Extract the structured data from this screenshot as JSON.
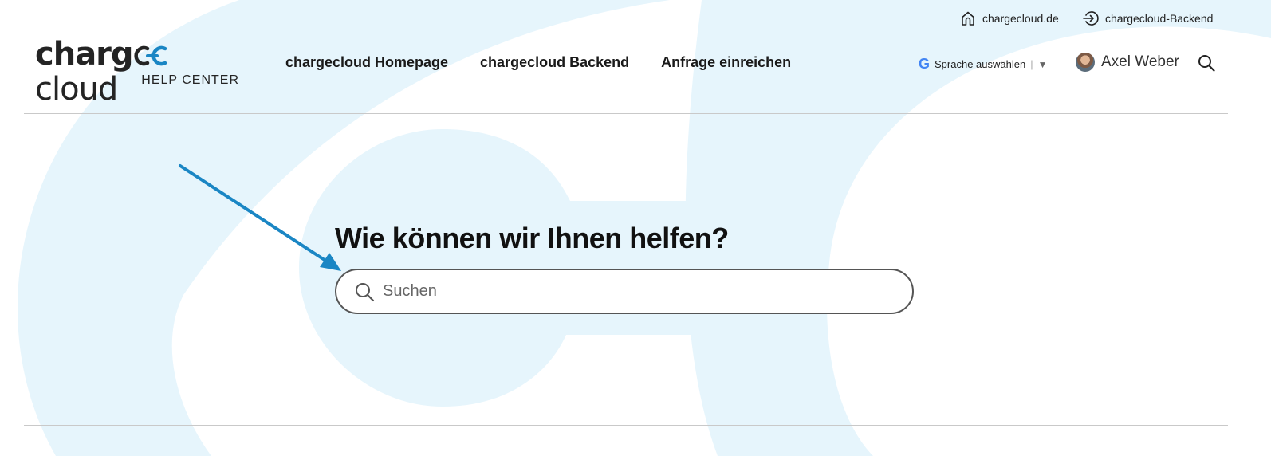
{
  "utility_links": [
    {
      "label": "chargecloud.de",
      "icon": "home-icon"
    },
    {
      "label": "chargecloud-Backend",
      "icon": "login-arrow-icon"
    }
  ],
  "logo": {
    "word_part1": "charg",
    "word_part2": "cloud",
    "subtitle": "HELP CENTER"
  },
  "nav": [
    {
      "label": "chargecloud Homepage"
    },
    {
      "label": "chargecloud Backend"
    },
    {
      "label": "Anfrage einreichen"
    }
  ],
  "language": {
    "g_letter": "G",
    "label": "Sprache auswählen",
    "separator": "|",
    "dropdown": "▼"
  },
  "user": {
    "name": "Axel Weber"
  },
  "hero": {
    "title": "Wie können wir Ihnen helfen?",
    "search_placeholder": "Suchen"
  },
  "colors": {
    "background_shape": "#e6f5fc",
    "accent_arrow": "#1a86c4",
    "logo_accent": "#1a86c4"
  }
}
